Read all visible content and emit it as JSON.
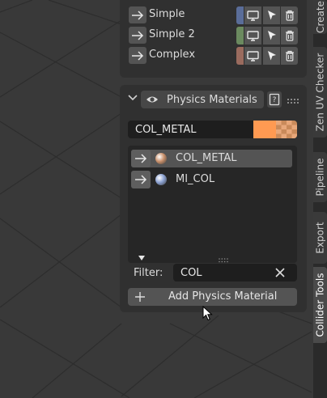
{
  "collision_presets": [
    {
      "label": "Simple",
      "color": "#5a6d99"
    },
    {
      "label": "Simple 2",
      "color": "#6b8a5f"
    },
    {
      "label": "Complex",
      "color": "#9a6b5e"
    }
  ],
  "physics_panel": {
    "title": "Physics Materials",
    "active_material_name": "COL_METAL",
    "active_material_color": "#ff9a52",
    "materials": [
      {
        "name": "COL_METAL",
        "selected": true,
        "ball_color": "#c9906b"
      },
      {
        "name": "MI_COL",
        "selected": false,
        "ball_color": "#8aa0d0"
      }
    ],
    "filter_label": "Filter:",
    "filter_value": "COL",
    "add_button_label": "Add Physics Material"
  },
  "sidebar_tabs": [
    {
      "label": "Create",
      "active": false
    },
    {
      "label": "Zen UV Checker",
      "active": false
    },
    {
      "label": "Pipeline",
      "active": false
    },
    {
      "label": "Export",
      "active": false
    },
    {
      "label": "Collider Tools",
      "active": true
    }
  ],
  "icons": [
    "right-arrow-icon",
    "monitor-icon",
    "cursor-icon",
    "trash-icon",
    "eye-icon",
    "help-book-icon",
    "drag-handle-icon",
    "close-icon",
    "plus-icon",
    "chevron-down-icon",
    "triangle-down-icon"
  ]
}
